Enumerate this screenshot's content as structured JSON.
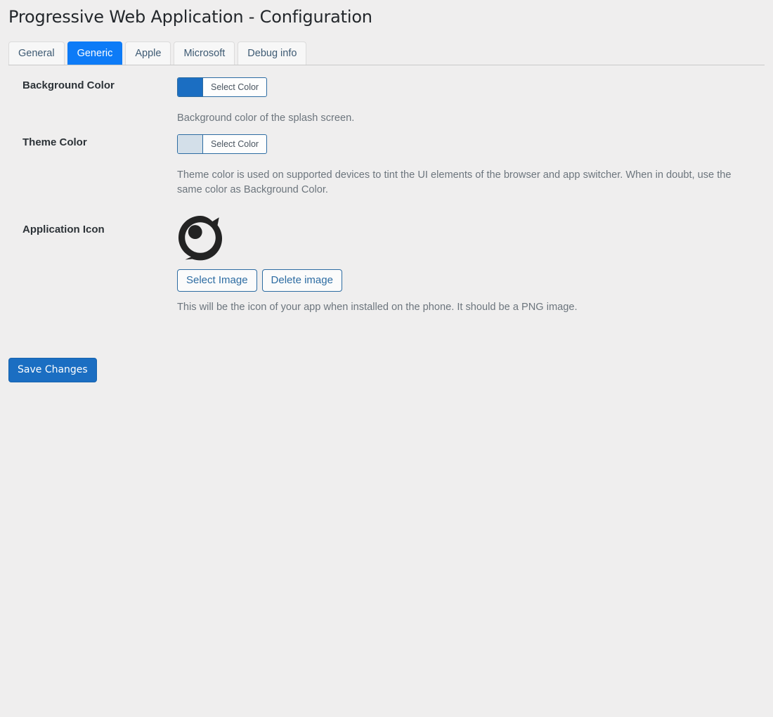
{
  "page": {
    "title": "Progressive Web Application - Configuration",
    "background_color": "#efeeee"
  },
  "tabs": [
    {
      "label": "General",
      "active": false
    },
    {
      "label": "Generic",
      "active": true
    },
    {
      "label": "Apple",
      "active": false
    },
    {
      "label": "Microsoft",
      "active": false
    },
    {
      "label": "Debug info",
      "active": false
    }
  ],
  "colors": {
    "tab_active_bg": "#0d7bf7",
    "tab_active_text": "#ffffff",
    "link_blue": "#2d6ca2",
    "primary_button_bg": "#1b6ec2",
    "help_text": "#6c757d"
  },
  "fields": {
    "background_color": {
      "label": "Background Color",
      "button_label": "Select Color",
      "value": "#1b6ec2",
      "help": "Background color of the splash screen."
    },
    "theme_color": {
      "label": "Theme Color",
      "button_label": "Select Color",
      "value": "#d3dfe9",
      "help": "Theme color is used on supported devices to tint the UI elements of the browser and app switcher. When in doubt, use the same color as Background Color."
    },
    "application_icon": {
      "label": "Application Icon",
      "icon_name": "app-logo-ring",
      "icon_color": "#232323",
      "select_label": "Select Image",
      "delete_label": "Delete image",
      "help": "This will be the icon of your app when installed on the phone. It should be a PNG image."
    }
  },
  "actions": {
    "save_label": "Save Changes"
  }
}
